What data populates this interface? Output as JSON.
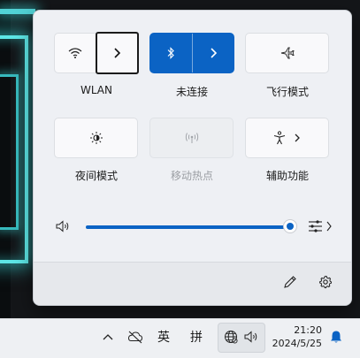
{
  "quick_settings": {
    "tiles": [
      {
        "label": "WLAN",
        "icon": "wifi-icon",
        "state": "off",
        "has_more": true
      },
      {
        "label": "未连接",
        "icon": "bluetooth-icon",
        "state": "on",
        "has_more": true
      },
      {
        "label": "飞行模式",
        "icon": "airplane-icon",
        "state": "off",
        "has_more": false
      },
      {
        "label": "夜间模式",
        "icon": "brightness-icon",
        "state": "off",
        "has_more": false
      },
      {
        "label": "移动热点",
        "icon": "hotspot-icon",
        "state": "disabled",
        "has_more": false
      },
      {
        "label": "辅助功能",
        "icon": "accessibility-icon",
        "state": "off",
        "has_more": true
      }
    ],
    "volume": {
      "level_percent": 100,
      "icon": "speaker-icon",
      "output_icon": "audio-output-icon"
    },
    "footer": {
      "edit_icon": "pencil-icon",
      "settings_icon": "gear-icon"
    }
  },
  "taskbar": {
    "overflow_icon": "chevron-up-icon",
    "network_off_icon": "network-disconnected-icon",
    "ime_lang": "英",
    "ime_mode": "拼",
    "globe_icon": "globe-icon",
    "speaker_icon": "speaker-icon",
    "time": "21:20",
    "date": "2024/5/25",
    "notification_icon": "bell-icon"
  },
  "colors": {
    "accent": "#0b63c4",
    "panel_bg": "#eef0f4"
  }
}
